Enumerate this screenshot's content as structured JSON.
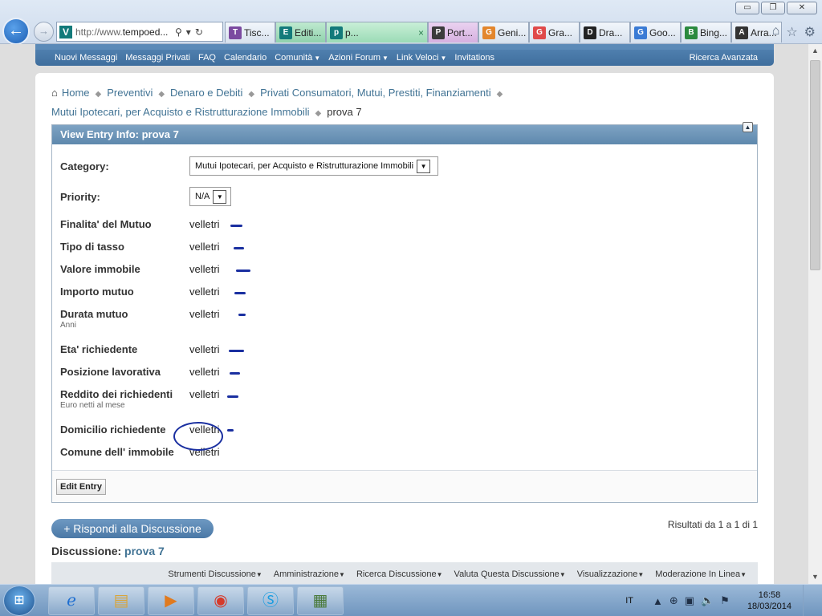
{
  "browser": {
    "address": "http://www.tempoed...",
    "address_prefix": "http://www.",
    "address_host": "tempoed...",
    "tabs": [
      {
        "label": "Tisc...",
        "icon": "tiscali-icon",
        "color": "#7b4aa0"
      },
      {
        "label": "Editi...",
        "icon": "tempoed-icon",
        "color": "#137a7a"
      },
      {
        "label": "p...",
        "icon": "tempoed-icon",
        "color": "#137a7a"
      },
      {
        "label": "Port...",
        "icon": "portal-icon",
        "color": "#3b3b3b"
      },
      {
        "label": "Geni...",
        "icon": "geni-icon",
        "color": "#e3862d"
      },
      {
        "label": "Gra...",
        "icon": "yp-icon",
        "color": "#e04a4a"
      },
      {
        "label": "Dra...",
        "icon": "dragon-icon",
        "color": "#222222"
      },
      {
        "label": "Goo...",
        "icon": "translate-icon",
        "color": "#3a7bd5"
      },
      {
        "label": "Bing...",
        "icon": "bing-icon",
        "color": "#2b8a3e"
      },
      {
        "label": "Arra...",
        "icon": "wikipedia-icon",
        "color": "#333333"
      }
    ],
    "tab_close": "×"
  },
  "navbar": {
    "items": [
      {
        "label": "Nuovi Messaggi",
        "caret": false
      },
      {
        "label": "Messaggi Privati",
        "caret": false
      },
      {
        "label": "FAQ",
        "caret": false
      },
      {
        "label": "Calendario",
        "caret": false
      },
      {
        "label": "Comunità",
        "caret": true
      },
      {
        "label": "Azioni Forum",
        "caret": true
      },
      {
        "label": "Link Veloci",
        "caret": true
      },
      {
        "label": "Invitations",
        "caret": false
      }
    ],
    "right": "Ricerca Avanzata"
  },
  "breadcrumb": {
    "items": [
      "Home",
      "Preventivi",
      "Denaro e Debiti",
      "Privati Consumatori, Mutui, Prestiti, Finanziamenti",
      "Mutui Ipotecari, per Acquisto e Ristrutturazione Immobili"
    ],
    "current": "prova 7"
  },
  "panel": {
    "title": "View Entry Info: prova 7",
    "category_label": "Category:",
    "category_value": "Mutui Ipotecari, per Acquisto e Ristrutturazione Immobili",
    "priority_label": "Priority:",
    "priority_value": "N/A",
    "fields": [
      {
        "label": "Finalita' del Mutuo",
        "sub": "",
        "value": "velletri"
      },
      {
        "label": "Tipo di tasso",
        "sub": "",
        "value": "velletri"
      },
      {
        "label": "Valore immobile",
        "sub": "",
        "value": "velletri"
      },
      {
        "label": "Importo mutuo",
        "sub": "",
        "value": "velletri"
      },
      {
        "label": "Durata mutuo",
        "sub": "Anni",
        "value": "velletri"
      },
      {
        "label": "Eta' richiedente",
        "sub": "",
        "value": "velletri"
      },
      {
        "label": "Posizione lavorativa",
        "sub": "",
        "value": "velletri"
      },
      {
        "label": "Reddito dei richiedenti",
        "sub": "Euro netti al mese",
        "value": "velletri"
      },
      {
        "label": "Domicilio richiedente",
        "sub": "",
        "value": "velletri"
      },
      {
        "label": "Comune dell' immobile",
        "sub": "",
        "value": "velletri"
      }
    ],
    "edit_button": "Edit Entry"
  },
  "reply_button": "+ Rispondi alla Discussione",
  "results": "Risultati da 1 a 1 di 1",
  "discussion": {
    "label": "Discussione:",
    "title": "prova 7"
  },
  "thread_tools": [
    "Strumenti Discussione",
    "Amministrazione",
    "Ricerca Discussione",
    "Valuta Questa Discussione",
    "Visualizzazione",
    "Moderazione In Linea"
  ],
  "taskbar": {
    "apps": [
      "internet-explorer-icon",
      "file-explorer-icon",
      "media-player-icon",
      "chrome-icon",
      "skype-icon",
      "calculator-icon"
    ],
    "lang": "IT",
    "time": "16:58",
    "date": "18/03/2014"
  },
  "colors": {
    "accent": "#4a78a6",
    "link": "#417394",
    "annotation": "#1a2fa0"
  }
}
